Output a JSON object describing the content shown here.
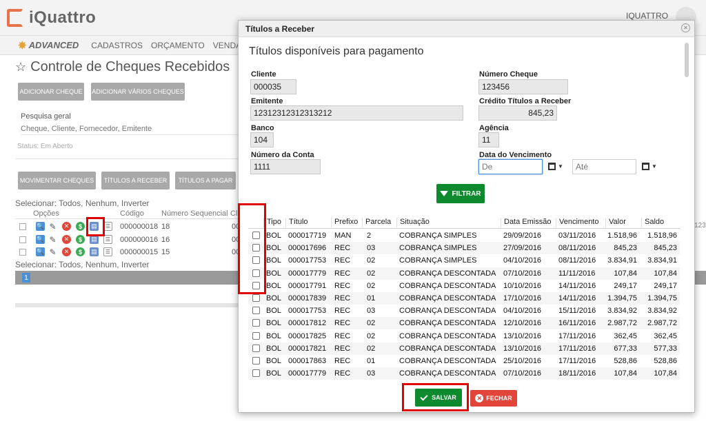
{
  "app": {
    "logo": "iQuattro",
    "user": "IQUATTRO",
    "brand": "ADVANCED",
    "menu": [
      "CADASTROS",
      "ORÇAMENTO",
      "VENDAS"
    ]
  },
  "page": {
    "title": "Controle de Cheques Recebidos",
    "buttons": {
      "add_check": "ADICIONAR CHEQUE",
      "add_many": "ADICIONAR VÁRIOS CHEQUES",
      "move_checks": "MOVIMENTAR CHEQUES",
      "receivables": "TÍTULOS A RECEBER",
      "payables": "TÍTULOS A PAGAR"
    },
    "search_label": "Pesquisa geral",
    "search_placeholder": "Cheque, Cliente, Fornecedor, Emitente",
    "status": "Status: Em Aberto",
    "select_line": "Selecionar: Todos, Nenhum, Inverter",
    "table_headers": [
      "Opções",
      "Código",
      "Número Sequencial",
      "Cl"
    ],
    "rows": [
      {
        "codigo": "000000018",
        "seq": "18",
        "cl": "00"
      },
      {
        "codigo": "000000016",
        "seq": "16",
        "cl": "00"
      },
      {
        "codigo": "000000015",
        "seq": "15",
        "cl": "00"
      }
    ],
    "page_number": "1",
    "right_fragment": "123"
  },
  "modal": {
    "title": "Títulos a Receber",
    "subtitle": "Títulos disponíveis para pagamento",
    "fields": {
      "cliente_label": "Cliente",
      "cliente": "000035",
      "numero_cheque_label": "Número Cheque",
      "numero_cheque": "123456",
      "emitente_label": "Emitente",
      "emitente": "12312312312313212",
      "credito_label": "Crédito Títulos a Receber",
      "credito": "845,23",
      "banco_label": "Banco",
      "banco": "104",
      "agencia_label": "Agência",
      "agencia": "11",
      "conta_label": "Número da Conta",
      "conta": "1111",
      "vencimento_label": "Data do Vencimento",
      "de_placeholder": "De",
      "ate_placeholder": "Até"
    },
    "filter_label": "FILTRAR",
    "columns": [
      "Tipo",
      "Título",
      "Prefixo",
      "Parcela",
      "Situação",
      "Data Emissão",
      "Vencimento",
      "Valor",
      "Saldo"
    ],
    "rows": [
      [
        "BOL",
        "000017719",
        "MAN",
        "2",
        "COBRANÇA SIMPLES",
        "29/09/2016",
        "03/11/2016",
        "1.518,96",
        "1.518,96"
      ],
      [
        "BOL",
        "000017696",
        "REC",
        "03",
        "COBRANÇA SIMPLES",
        "27/09/2016",
        "08/11/2016",
        "845,23",
        "845,23"
      ],
      [
        "BOL",
        "000017753",
        "REC",
        "02",
        "COBRANÇA SIMPLES",
        "04/10/2016",
        "08/11/2016",
        "3.834,91",
        "3.834,91"
      ],
      [
        "BOL",
        "000017779",
        "REC",
        "02",
        "COBRANÇA DESCONTADA",
        "07/10/2016",
        "11/11/2016",
        "107,84",
        "107,84"
      ],
      [
        "BOL",
        "000017791",
        "REC",
        "02",
        "COBRANÇA DESCONTADA",
        "10/10/2016",
        "14/11/2016",
        "249,17",
        "249,17"
      ],
      [
        "BOL",
        "000017839",
        "REC",
        "01",
        "COBRANÇA DESCONTADA",
        "17/10/2016",
        "14/11/2016",
        "1.394,75",
        "1.394,75"
      ],
      [
        "BOL",
        "000017753",
        "REC",
        "03",
        "COBRANÇA DESCONTADA",
        "04/10/2016",
        "15/11/2016",
        "3.834,92",
        "3.834,92"
      ],
      [
        "BOL",
        "000017812",
        "REC",
        "02",
        "COBRANÇA DESCONTADA",
        "12/10/2016",
        "16/11/2016",
        "2.987,72",
        "2.987,72"
      ],
      [
        "BOL",
        "000017825",
        "REC",
        "02",
        "COBRANÇA DESCONTADA",
        "13/10/2016",
        "17/11/2016",
        "362,45",
        "362,45"
      ],
      [
        "BOL",
        "000017821",
        "REC",
        "02",
        "COBRANÇA DESCONTADA",
        "13/10/2016",
        "17/11/2016",
        "677,33",
        "577,33"
      ],
      [
        "BOL",
        "000017863",
        "REC",
        "01",
        "COBRANÇA DESCONTADA",
        "25/10/2016",
        "17/11/2016",
        "528,86",
        "528,86"
      ],
      [
        "BOL",
        "000017779",
        "REC",
        "03",
        "COBRANÇA DESCONTADA",
        "07/10/2016",
        "18/11/2016",
        "107,84",
        "107,84"
      ]
    ],
    "save_label": "SALVAR",
    "close_label": "FECHAR"
  },
  "colors": {
    "green": "#0c8a2d",
    "red": "#e2453a",
    "highlight": "#e00000"
  }
}
